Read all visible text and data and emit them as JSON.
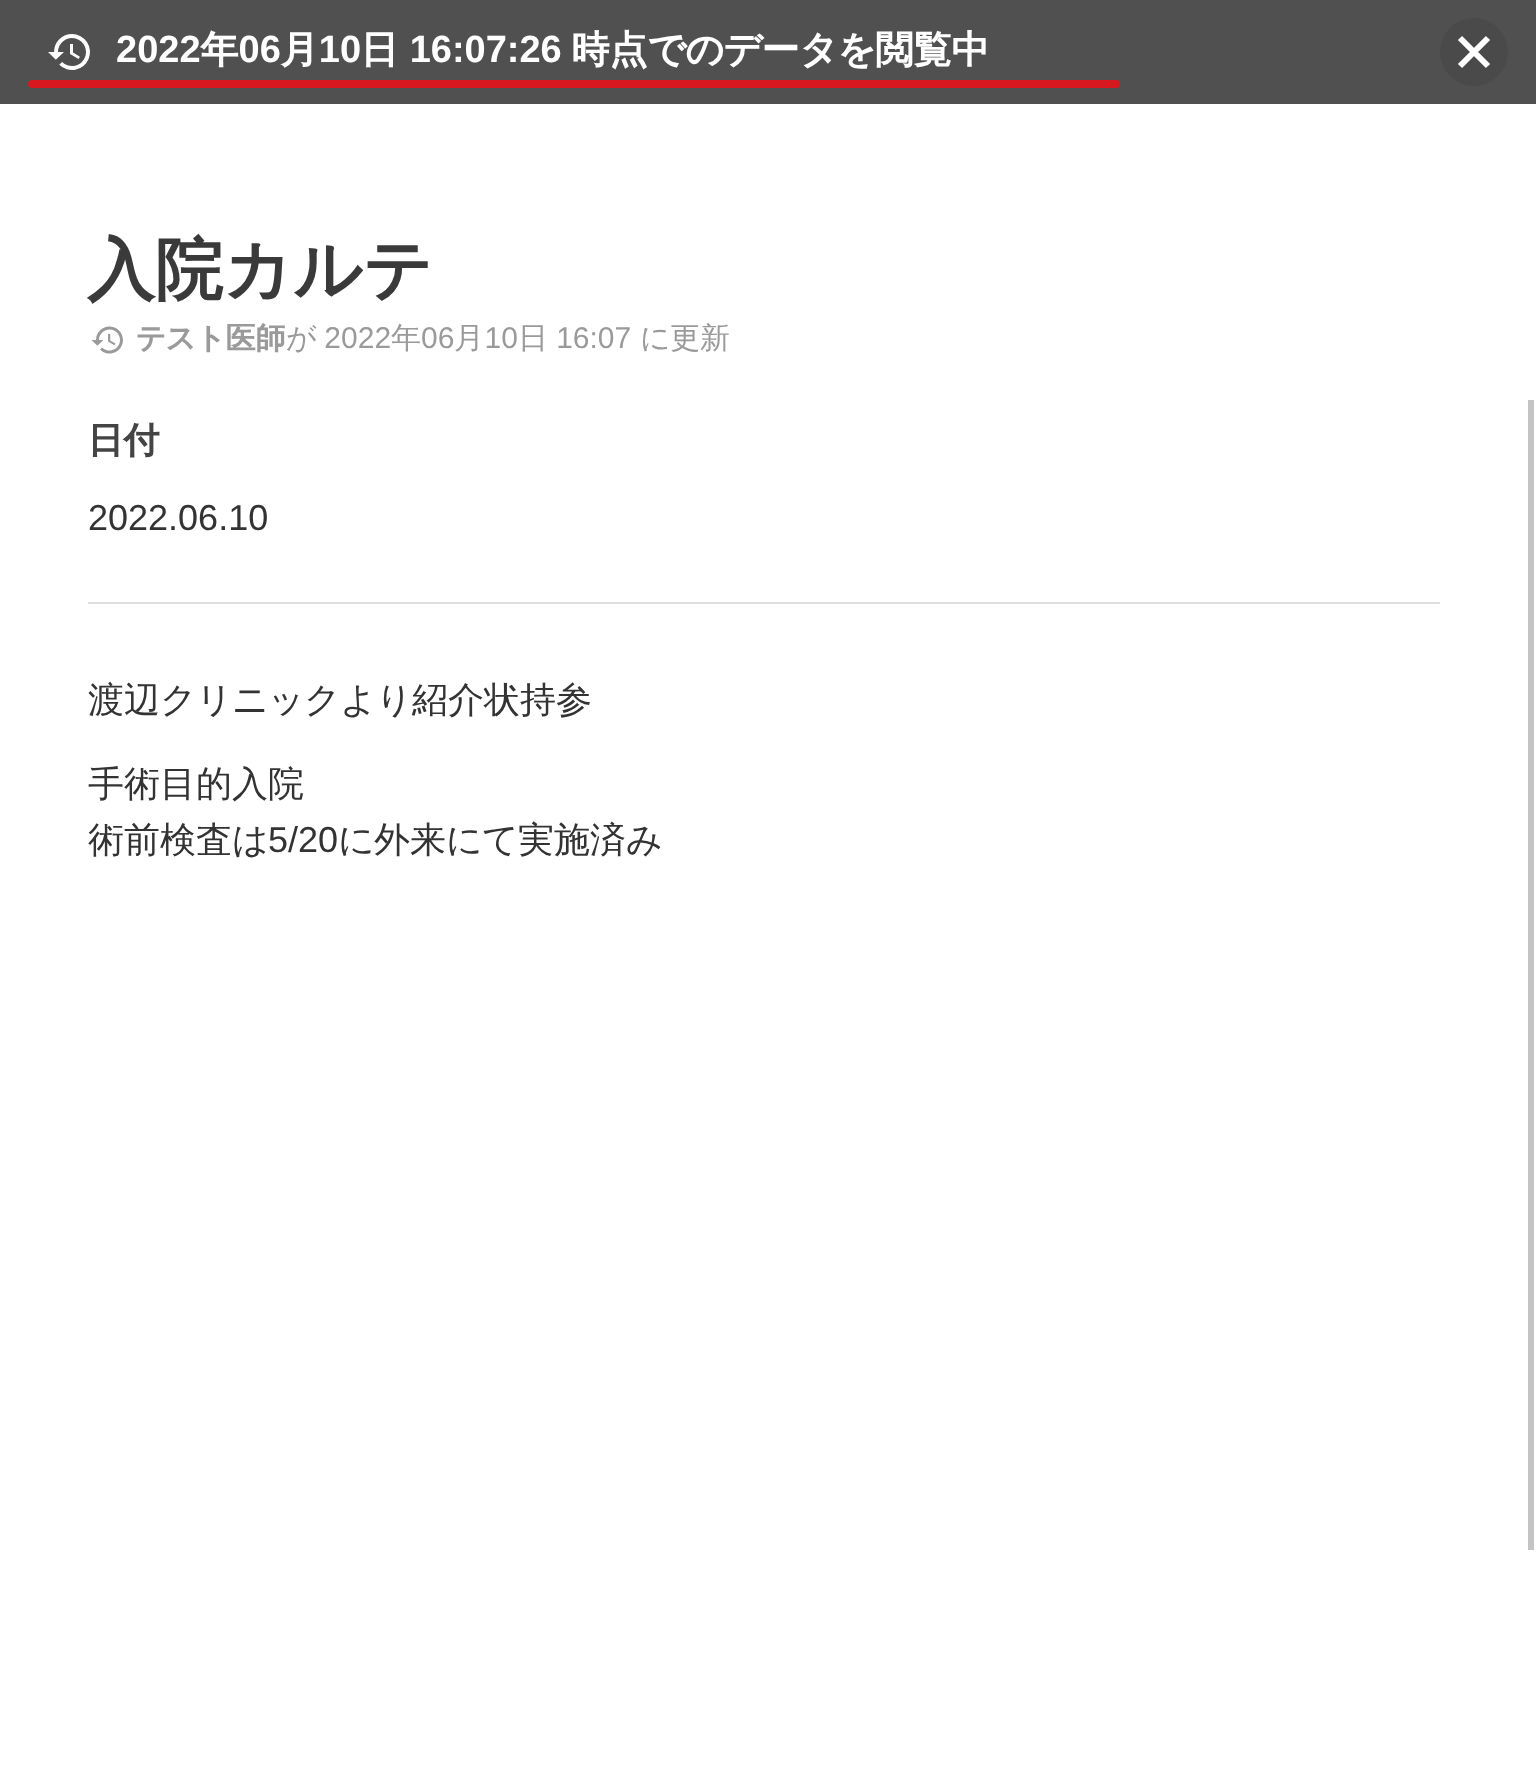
{
  "banner": {
    "text": "2022年06月10日 16:07:26 時点でのデータを閲覧中"
  },
  "record": {
    "title": "入院カルテ",
    "meta": "**テスト医師**が 2022年06月10日 16:07 に更新"
  },
  "fields": [
    {
      "label": "日付",
      "value": "2022.06.10"
    }
  ],
  "notes": [
    [
      "渡辺クリニックより紹介状持参"
    ],
    [
      "手術目的入院",
      "術前検査は5/20に外来にて実施済み"
    ]
  ]
}
